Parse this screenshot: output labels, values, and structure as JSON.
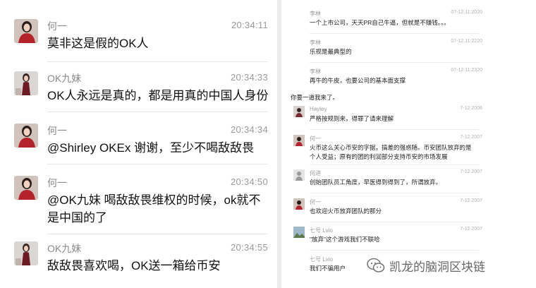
{
  "left_chat": {
    "messages": [
      {
        "name": "何一",
        "time": "20:34:11",
        "text": "莫非这是假的OK人",
        "avatar": "woman-red-dress"
      },
      {
        "name": "OK九妹",
        "time": "20:34:33",
        "text": "OK人永远是真的，都是用真的中国人身份",
        "avatar": "woman-standing"
      },
      {
        "name": "何一",
        "time": "20:34:34",
        "text": "@Shirley OKEx 谢谢，至少不喝敌敌畏",
        "avatar": "woman-red-dress"
      },
      {
        "name": "何一",
        "time": "20:34:50",
        "text": "@OK九妹 喝敌敌畏维权的时候，ok就不是中国的了",
        "avatar": "woman-red-dress"
      },
      {
        "name": "OK九妹",
        "time": "20:34:55",
        "text": "敌敌畏喜欢喝，OK送一箱给币安",
        "avatar": "woman-standing"
      }
    ]
  },
  "right_chat": {
    "messages": [
      {
        "name": "李林",
        "time": "07-12 11:2020",
        "text": "一个上市公司，天天PR自己牛逼，但就是不赚钱。。。"
      },
      {
        "name": "李林",
        "time": "07-12 11:2220",
        "text": "乐视是最典型的"
      },
      {
        "name": "李林",
        "time": "07-12 11:2320",
        "text": "再牛的牛皮，也要公司的基本面支撑"
      },
      {
        "name": "Hayley",
        "time": "7-12 2006",
        "text": "严格按规则来，得罪了请来理解"
      },
      {
        "name": "何一",
        "time": "7-12 2007",
        "text": "火币这么关心币安的字据，搞差的强惑随。币安团队放弃的是个人受益；原有的团的利润部分支持币安的市场发展"
      },
      {
        "name": "何进",
        "time": "7-12 2007",
        "text": "创始团队员工角度，早医得到得到了，所谓放弃。"
      },
      {
        "name": "何一",
        "time": "7-12 2007",
        "text": "也欢迎火币放弃团队的那分"
      },
      {
        "name": "七号 Lvio",
        "time": "7-12 2007",
        "text": "\"放弃\"这个游戏我们不联哈"
      },
      {
        "name": "七号 Lvio",
        "time": "",
        "text": "我们不骗用户"
      }
    ],
    "inline_text": "你要一道我来了。"
  },
  "watermark": {
    "label": "凯龙的脑洞区块链",
    "icon": "wechat-icon"
  },
  "colors": {
    "avatar_red": "#b4232b",
    "name_gray": "#8a8a8a",
    "text_black": "#111111"
  }
}
